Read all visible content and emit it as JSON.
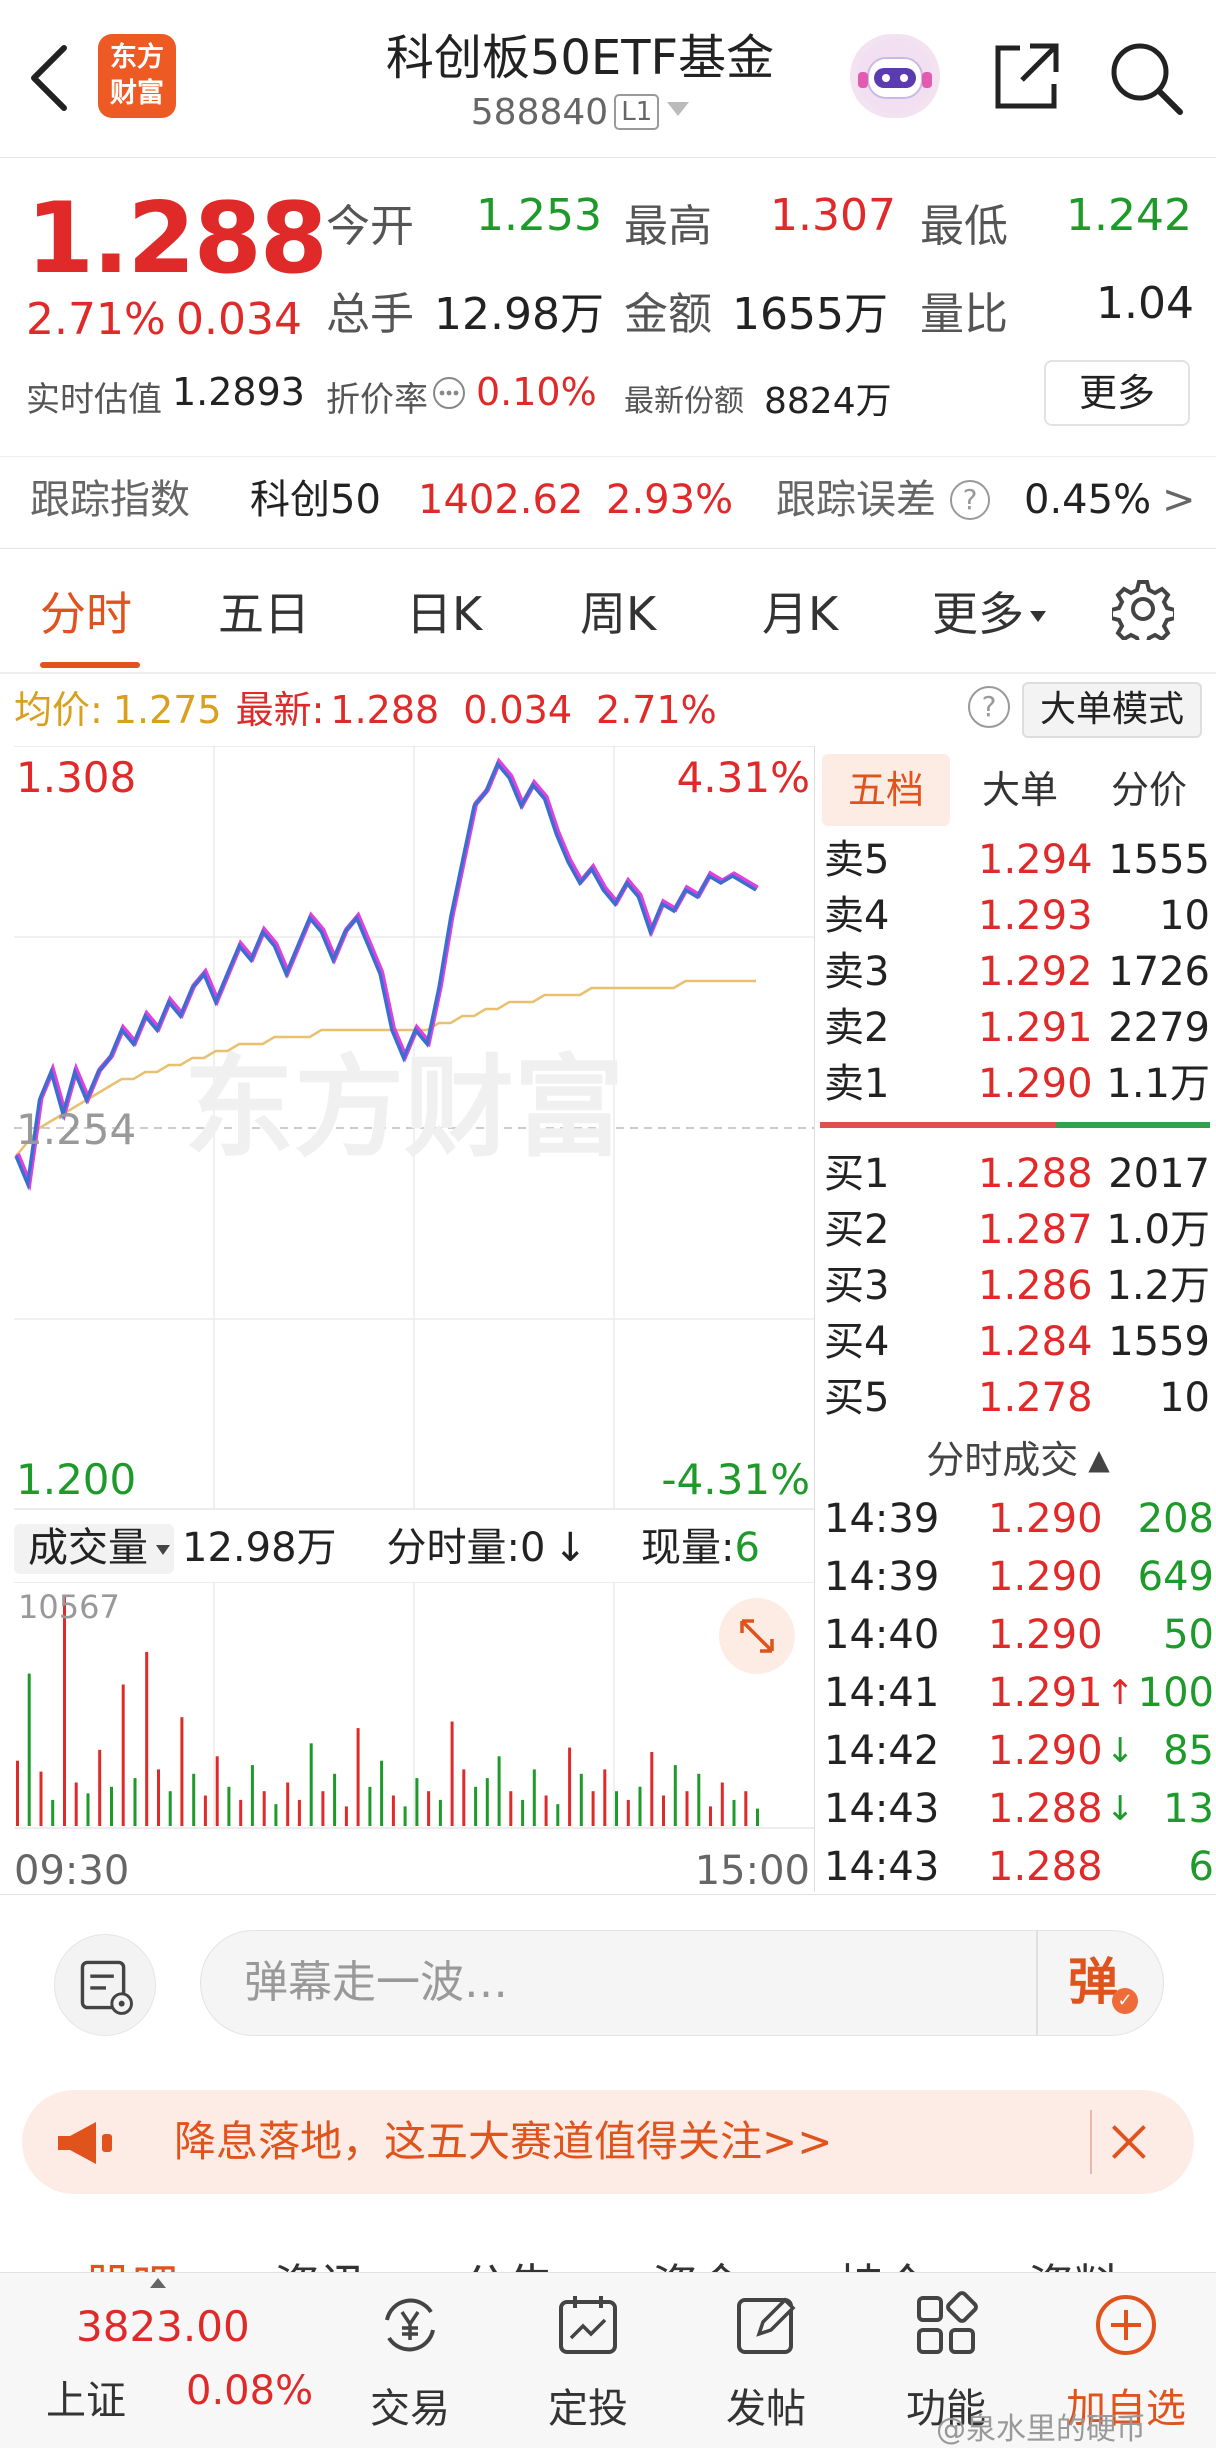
{
  "header": {
    "logo_line1": "东方",
    "logo_line2": "财富",
    "title": "科创板50ETF基金",
    "code": "588840",
    "level": "L1"
  },
  "quote": {
    "price": "1.288",
    "pct": "2.71%",
    "change": "0.034",
    "open_label": "今开",
    "open": "1.253",
    "high_label": "最高",
    "high": "1.307",
    "low_label": "最低",
    "low": "1.242",
    "volume_label": "总手",
    "volume": "12.98万",
    "amount_label": "金额",
    "amount": "1655万",
    "vol_ratio_label": "量比",
    "vol_ratio": "1.04",
    "iopv_label": "实时估值",
    "iopv": "1.2893",
    "discount_label": "折价率",
    "discount": "0.10%",
    "shares_label": "最新份额",
    "shares": "8824万",
    "more_button": "更多"
  },
  "tracking": {
    "label": "跟踪指数",
    "index_name": "科创50",
    "index_value": "1402.62",
    "index_pct": "2.93%",
    "error_label": "跟踪误差",
    "error_value": "0.45%",
    "arrow": ">"
  },
  "tabs": [
    "分时",
    "五日",
    "日K",
    "周K",
    "月K",
    "更多"
  ],
  "avg_bar": {
    "avg_label": "均价:",
    "avg_value": "1.275",
    "latest_label": "最新:",
    "latest_value": "1.288",
    "latest_change": "0.034",
    "latest_pct": "2.71%",
    "help": "?",
    "big_order_mode": "大单模式"
  },
  "chart_data": {
    "type": "line",
    "y_top": "1.308",
    "y_mid": "1.254",
    "y_bottom": "1.200",
    "pct_top": "4.31%",
    "pct_bottom": "-4.31%",
    "ylim": [
      1.2,
      1.308
    ],
    "x_start": "09:30",
    "x_end": "15:00",
    "watermark": "东方财富",
    "colors": {
      "price": "#3a6fd0",
      "price_shadow": "#e040e0",
      "avg": "#e8c070",
      "up": "#e02a2a",
      "down": "#1d9a2a"
    },
    "price_series": [
      1.25,
      1.246,
      1.258,
      1.262,
      1.256,
      1.262,
      1.258,
      1.262,
      1.264,
      1.268,
      1.266,
      1.27,
      1.268,
      1.272,
      1.27,
      1.274,
      1.276,
      1.272,
      1.276,
      1.28,
      1.278,
      1.282,
      1.28,
      1.276,
      1.28,
      1.284,
      1.282,
      1.278,
      1.282,
      1.284,
      1.28,
      1.276,
      1.268,
      1.264,
      1.268,
      1.266,
      1.274,
      1.284,
      1.292,
      1.3,
      1.302,
      1.306,
      1.304,
      1.3,
      1.303,
      1.301,
      1.296,
      1.292,
      1.289,
      1.291,
      1.288,
      1.286,
      1.289,
      1.287,
      1.282,
      1.286,
      1.285,
      1.288,
      1.287,
      1.29,
      1.289,
      1.29,
      1.289,
      1.288
    ],
    "avg_series": [
      1.25,
      1.252,
      1.254,
      1.255,
      1.256,
      1.257,
      1.258,
      1.259,
      1.26,
      1.261,
      1.261,
      1.262,
      1.262,
      1.263,
      1.263,
      1.264,
      1.264,
      1.265,
      1.265,
      1.266,
      1.266,
      1.266,
      1.267,
      1.267,
      1.267,
      1.267,
      1.268,
      1.268,
      1.268,
      1.268,
      1.268,
      1.268,
      1.268,
      1.268,
      1.268,
      1.268,
      1.269,
      1.269,
      1.27,
      1.27,
      1.271,
      1.271,
      1.272,
      1.272,
      1.272,
      1.273,
      1.273,
      1.273,
      1.273,
      1.274,
      1.274,
      1.274,
      1.274,
      1.274,
      1.274,
      1.274,
      1.274,
      1.275,
      1.275,
      1.275,
      1.275,
      1.275,
      1.275,
      1.275
    ],
    "volume_max_label": "10567",
    "volume_max": 10567,
    "volume_series": [
      3000,
      7000,
      2500,
      1200,
      10567,
      2000,
      1500,
      3500,
      1800,
      6500,
      2200,
      8000,
      2600,
      1600,
      5000,
      2400,
      1400,
      3200,
      1800,
      1200,
      2800,
      1600,
      1000,
      2000,
      1200,
      3800,
      1600,
      2400,
      900,
      4500,
      1800,
      3000,
      1400,
      900,
      2200,
      1600,
      1200,
      4800,
      2600,
      1800,
      2200,
      3200,
      1600,
      1200,
      2600,
      1400,
      1000,
      3600,
      2400,
      1600,
      2600,
      1600,
      1200,
      1800,
      3400,
      1400,
      2800,
      1600,
      2400,
      900,
      2000,
      1200,
      1600,
      800
    ],
    "volume_colors": [
      "r",
      "g",
      "r",
      "g",
      "r",
      "r",
      "g",
      "r",
      "g",
      "r",
      "g",
      "r",
      "r",
      "g",
      "r",
      "g",
      "r",
      "r",
      "g",
      "r",
      "g",
      "r",
      "g",
      "r",
      "r",
      "g",
      "r",
      "g",
      "r",
      "r",
      "g",
      "g",
      "r",
      "g",
      "g",
      "r",
      "g",
      "r",
      "r",
      "g",
      "g",
      "g",
      "r",
      "g",
      "g",
      "r",
      "g",
      "r",
      "g",
      "r",
      "r",
      "g",
      "r",
      "g",
      "r",
      "r",
      "g",
      "r",
      "g",
      "r",
      "r",
      "g",
      "r",
      "g"
    ]
  },
  "volume_header": {
    "selector": "成交量",
    "total": "12.98万",
    "interval_label": "分时量:0",
    "interval_arrow": "↓",
    "current_label": "现量:",
    "current": "6"
  },
  "order_book": {
    "tabs": [
      "五档",
      "大单",
      "分价"
    ],
    "asks": [
      {
        "label": "卖5",
        "price": "1.294",
        "vol": "1555"
      },
      {
        "label": "卖4",
        "price": "1.293",
        "vol": "10"
      },
      {
        "label": "卖3",
        "price": "1.292",
        "vol": "1726"
      },
      {
        "label": "卖2",
        "price": "1.291",
        "vol": "2279"
      },
      {
        "label": "卖1",
        "price": "1.290",
        "vol": "1.1万"
      }
    ],
    "bids": [
      {
        "label": "买1",
        "price": "1.288",
        "vol": "2017"
      },
      {
        "label": "买2",
        "price": "1.287",
        "vol": "1.0万"
      },
      {
        "label": "买3",
        "price": "1.286",
        "vol": "1.2万"
      },
      {
        "label": "买4",
        "price": "1.284",
        "vol": "1559"
      },
      {
        "label": "买5",
        "price": "1.278",
        "vol": "10"
      }
    ],
    "ask_ratio": 0.605
  },
  "trades": {
    "title": "分时成交",
    "title_arrow": "▲",
    "rows": [
      {
        "time": "14:39",
        "price": "1.290",
        "arrow": "",
        "vol": "208"
      },
      {
        "time": "14:39",
        "price": "1.290",
        "arrow": "",
        "vol": "649"
      },
      {
        "time": "14:40",
        "price": "1.290",
        "arrow": "",
        "vol": "50"
      },
      {
        "time": "14:41",
        "price": "1.291",
        "arrow": "↑",
        "vol": "100"
      },
      {
        "time": "14:42",
        "price": "1.290",
        "arrow": "↓",
        "vol": "85"
      },
      {
        "time": "14:43",
        "price": "1.288",
        "arrow": "↓",
        "vol": "13"
      },
      {
        "time": "14:43",
        "price": "1.288",
        "arrow": "",
        "vol": "6"
      }
    ]
  },
  "danmu": {
    "placeholder": "弹幕走一波…",
    "send_label": "弹"
  },
  "banner": {
    "text": "降息落地，这五大赛道值得关注>>"
  },
  "subtabs": [
    "股吧",
    "资讯",
    "公告",
    "资金",
    "持仓",
    "资料"
  ],
  "bottom_nav": {
    "index_value": "3823.00",
    "index_name": "上证",
    "index_pct": "0.08%",
    "items": [
      "交易",
      "定投",
      "发帖",
      "功能",
      "加自选"
    ]
  },
  "watermark_text": "@泉水里的硬币"
}
